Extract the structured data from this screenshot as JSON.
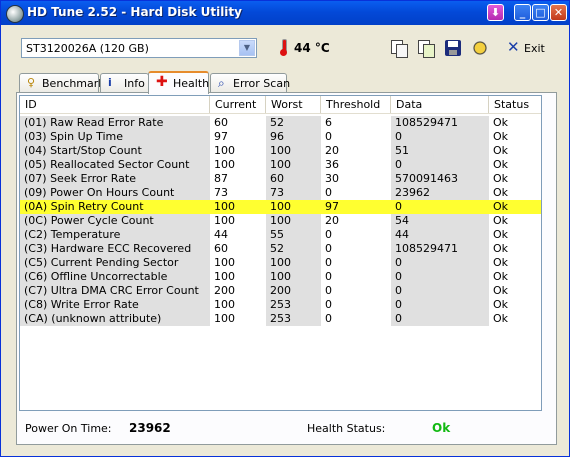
{
  "window": {
    "title": "HD Tune 2.52 - Hard Disk Utility"
  },
  "toolbar": {
    "drive": "ST3120026A (120 GB)",
    "temperature": "44 °C",
    "exit_label": "Exit"
  },
  "tabs": [
    {
      "label": "Benchmark"
    },
    {
      "label": "Info"
    },
    {
      "label": "Health"
    },
    {
      "label": "Error Scan"
    }
  ],
  "table": {
    "columns": [
      "ID",
      "Current",
      "Worst",
      "Threshold",
      "Data",
      "Status"
    ],
    "rows": [
      [
        "(01) Raw Read Error Rate",
        "60",
        "52",
        "6",
        "108529471",
        "Ok"
      ],
      [
        "(03) Spin Up Time",
        "97",
        "96",
        "0",
        "0",
        "Ok"
      ],
      [
        "(04) Start/Stop Count",
        "100",
        "100",
        "20",
        "51",
        "Ok"
      ],
      [
        "(05) Reallocated Sector Count",
        "100",
        "100",
        "36",
        "0",
        "Ok"
      ],
      [
        "(07) Seek Error Rate",
        "87",
        "60",
        "30",
        "570091463",
        "Ok"
      ],
      [
        "(09) Power On Hours Count",
        "73",
        "73",
        "0",
        "23962",
        "Ok"
      ],
      [
        "(0A) Spin Retry Count",
        "100",
        "100",
        "97",
        "0",
        "Ok"
      ],
      [
        "(0C) Power Cycle Count",
        "100",
        "100",
        "20",
        "54",
        "Ok"
      ],
      [
        "(C2) Temperature",
        "44",
        "55",
        "0",
        "44",
        "Ok"
      ],
      [
        "(C3) Hardware ECC Recovered",
        "60",
        "52",
        "0",
        "108529471",
        "Ok"
      ],
      [
        "(C5) Current Pending Sector",
        "100",
        "100",
        "0",
        "0",
        "Ok"
      ],
      [
        "(C6) Offline Uncorrectable",
        "100",
        "100",
        "0",
        "0",
        "Ok"
      ],
      [
        "(C7) Ultra DMA CRC Error Count",
        "200",
        "200",
        "0",
        "0",
        "Ok"
      ],
      [
        "(C8) Write Error Rate",
        "100",
        "253",
        "0",
        "0",
        "Ok"
      ],
      [
        "(CA) (unknown attribute)",
        "100",
        "253",
        "0",
        "0",
        "Ok"
      ]
    ],
    "highlight_row": 6,
    "highlight_color": "#FFFF30"
  },
  "footer": {
    "power_on_label": "Power On Time:",
    "power_on_value": "23962",
    "health_label": "Health Status:",
    "health_value": "Ok",
    "health_color": "#12B912"
  },
  "colors": {
    "titlebar": "#0A5EF0",
    "tab_active_accent": "#E68B2C",
    "window_bg": "#ECE9D8"
  }
}
